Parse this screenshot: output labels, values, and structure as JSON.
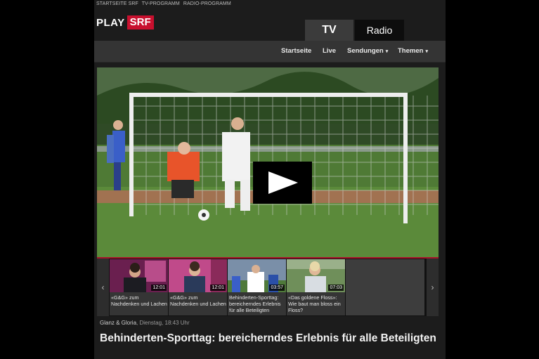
{
  "top_nav": [
    "STARTSEITE SRF",
    "TV-PROGRAMM",
    "RADIO-PROGRAMM"
  ],
  "logo": {
    "play": "PLAY",
    "srf": "SRF"
  },
  "tabs": {
    "tv": "TV",
    "radio": "Radio"
  },
  "main_nav": [
    {
      "label": "Startseite"
    },
    {
      "label": "Live"
    },
    {
      "label": "Sendungen",
      "caret": "▾"
    },
    {
      "label": "Themen",
      "caret": "▾"
    }
  ],
  "player": {
    "play_icon": "play-icon"
  },
  "thumbnails": [
    {
      "duration": "12:01",
      "caption": "«G&G» zum Nachdenken und Lachen"
    },
    {
      "duration": "12:01",
      "caption": "«G&G» zum Nachdenken und Lachen"
    },
    {
      "duration": "03:57",
      "caption": "Behinderten-Sporttag: bereicherndes Erlebnis für alle Beteiligten"
    },
    {
      "duration": "07:03",
      "caption": "«Das goldene Floss»: Wie baut man bloss ein Floss?"
    }
  ],
  "carousel": {
    "prev": "‹",
    "next": "›"
  },
  "meta": {
    "show": "Glanz & Gloria",
    "date": ", Dienstag, 18:43 Uhr"
  },
  "headline": "Behinderten-Sporttag: bereicherndes Erlebnis für alle Beteiligten",
  "colors": {
    "brand": "#c8102e",
    "background": "#1c1c1c",
    "nav": "#343434"
  }
}
